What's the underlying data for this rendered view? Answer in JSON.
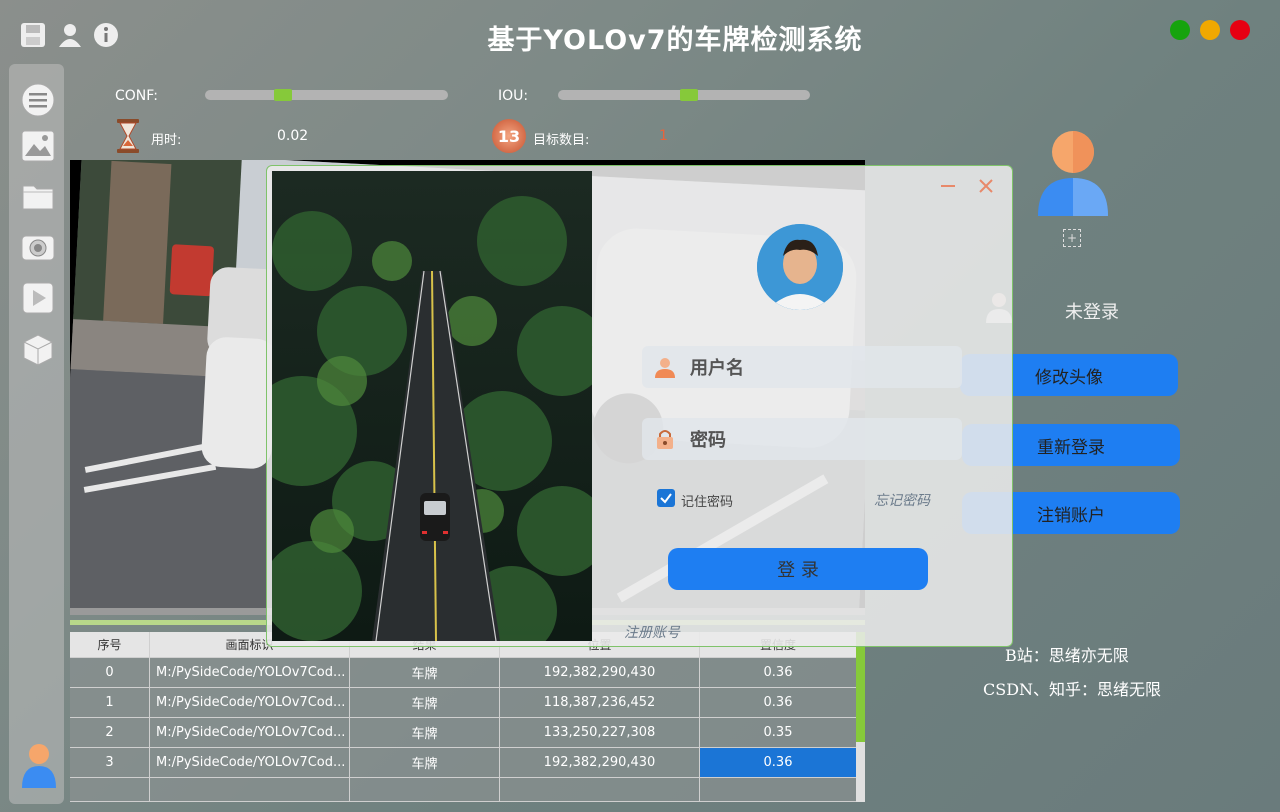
{
  "window": {
    "title": "基于YOLOv7的车牌检测系统",
    "dots": {
      "green": "#16a30d",
      "yellow": "#f0a800",
      "red": "#e60012"
    }
  },
  "toolbar": {
    "icons": [
      "save-icon",
      "user-icon",
      "info-icon"
    ]
  },
  "sidebar": {
    "items": [
      "menu-icon",
      "image-icon",
      "folder-icon",
      "camera-icon",
      "video-icon",
      "cube-icon",
      "avatar-icon"
    ]
  },
  "params": {
    "conf_label": "CONF:",
    "conf_value": 0.32,
    "iou_label": "IOU:",
    "iou_value": 0.52,
    "time_label": "用时:",
    "time_value": "0.02",
    "count_label": "目标数目:",
    "count_value": "1",
    "count_badge": "13"
  },
  "table": {
    "headers": [
      "序号",
      "画面标识",
      "结果",
      "位置",
      "置信度"
    ],
    "rows": [
      [
        "0",
        "M:/PySideCode/YOLOv7Cod...",
        "车牌",
        "192,382,290,430",
        "0.36"
      ],
      [
        "1",
        "M:/PySideCode/YOLOv7Cod...",
        "车牌",
        "118,387,236,452",
        "0.36"
      ],
      [
        "2",
        "M:/PySideCode/YOLOv7Cod...",
        "车牌",
        "133,250,227,308",
        "0.35"
      ],
      [
        "3",
        "M:/PySideCode/YOLOv7Cod...",
        "车牌",
        "192,382,290,430",
        "0.36"
      ]
    ]
  },
  "login": {
    "username_placeholder": "用户名",
    "password_placeholder": "密码",
    "remember_label": "记住密码",
    "forgot_label": "忘记密码",
    "login_button": "登 录",
    "register_label": "注册账号",
    "window_controls": [
      "minimize-icon",
      "close-icon"
    ]
  },
  "user_panel": {
    "status": "未登录",
    "change_avatar": "修改头像",
    "relogin": "重新登录",
    "logout": "注销账户",
    "credit1": "B站：思绪亦无限",
    "credit2": "CSDN、知乎：思绪无限"
  }
}
